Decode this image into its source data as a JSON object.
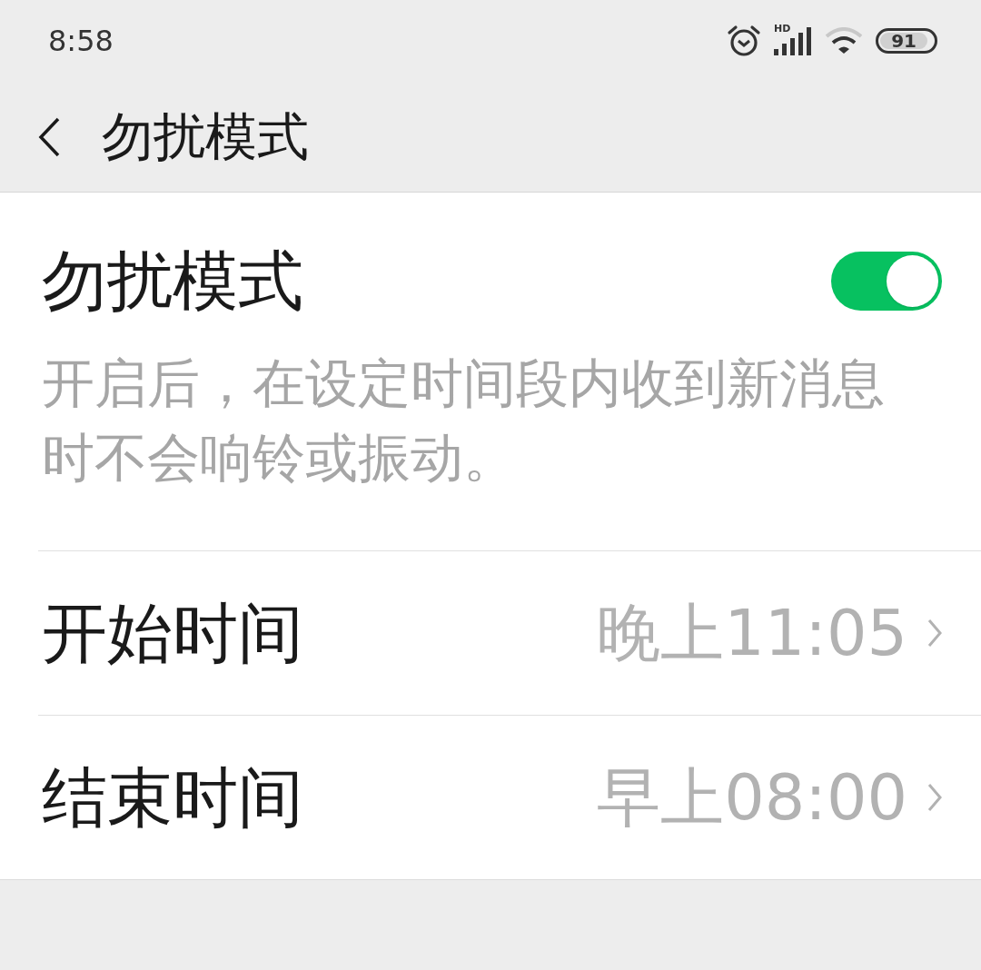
{
  "status_bar": {
    "time": "8:58",
    "network_label": "HD",
    "battery": "91"
  },
  "header": {
    "title": "勿扰模式"
  },
  "settings": {
    "toggle_row": {
      "label": "勿扰模式",
      "on": true
    },
    "description": "开启后，在设定时间段内收到新消息时不会响铃或振动。",
    "time_rows": [
      {
        "label": "开始时间",
        "value": "晚上11:05"
      },
      {
        "label": "结束时间",
        "value": "早上08:00"
      }
    ]
  }
}
